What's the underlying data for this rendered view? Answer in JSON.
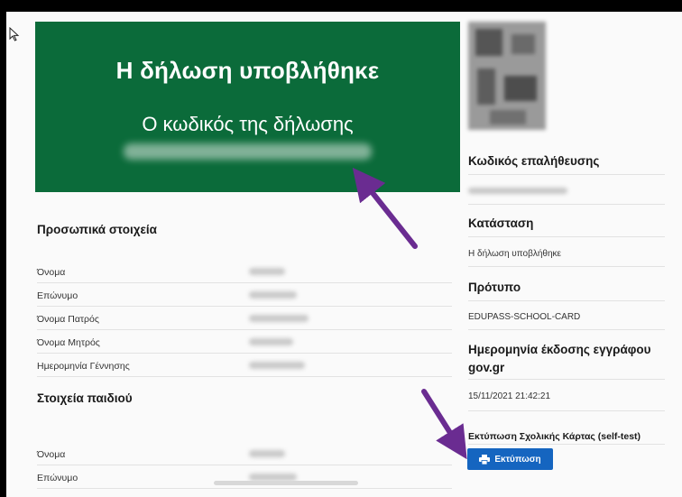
{
  "banner": {
    "title": "Η δήλωση υποβλήθηκε",
    "subtitle": "Ο κωδικός της δήλωσης",
    "code": "██████████████████"
  },
  "personal": {
    "title": "Προσωπικά στοιχεία",
    "rows": [
      {
        "label": "Όνομα",
        "value": "██████"
      },
      {
        "label": "Επώνυμο",
        "value": "██████"
      },
      {
        "label": "Όνομα Πατρός",
        "value": "█████"
      },
      {
        "label": "Όνομα Μητρός",
        "value": "██████"
      },
      {
        "label": "Ημερομηνία Γέννησης",
        "value": "██████"
      }
    ]
  },
  "child": {
    "title": "Στοιχεία παιδιού",
    "rows": [
      {
        "label": "Όνομα",
        "value": "█████"
      },
      {
        "label": "Επώνυμο",
        "value": "██████"
      }
    ]
  },
  "sidebar": {
    "verification_title": "Κωδικός επαλήθευσης",
    "verification_code": "████████████",
    "status_title": "Κατάσταση",
    "status_value": "Η δήλωση υποβλήθηκε",
    "template_title": "Πρότυπο",
    "template_value": "EDUPASS-SCHOOL-CARD",
    "issue_date_title": "Ημερομηνία έκδοσης εγγράφου gov.gr",
    "issue_date_value": "15/11/2021 21:42:21",
    "print_card_title": "Εκτύπωση Σχολικής Κάρτας (self-test)",
    "print_button": "Εκτύπωση"
  },
  "colors": {
    "banner": "#0b6b3a",
    "button": "#1565c0",
    "arrow": "#6a2c91"
  }
}
